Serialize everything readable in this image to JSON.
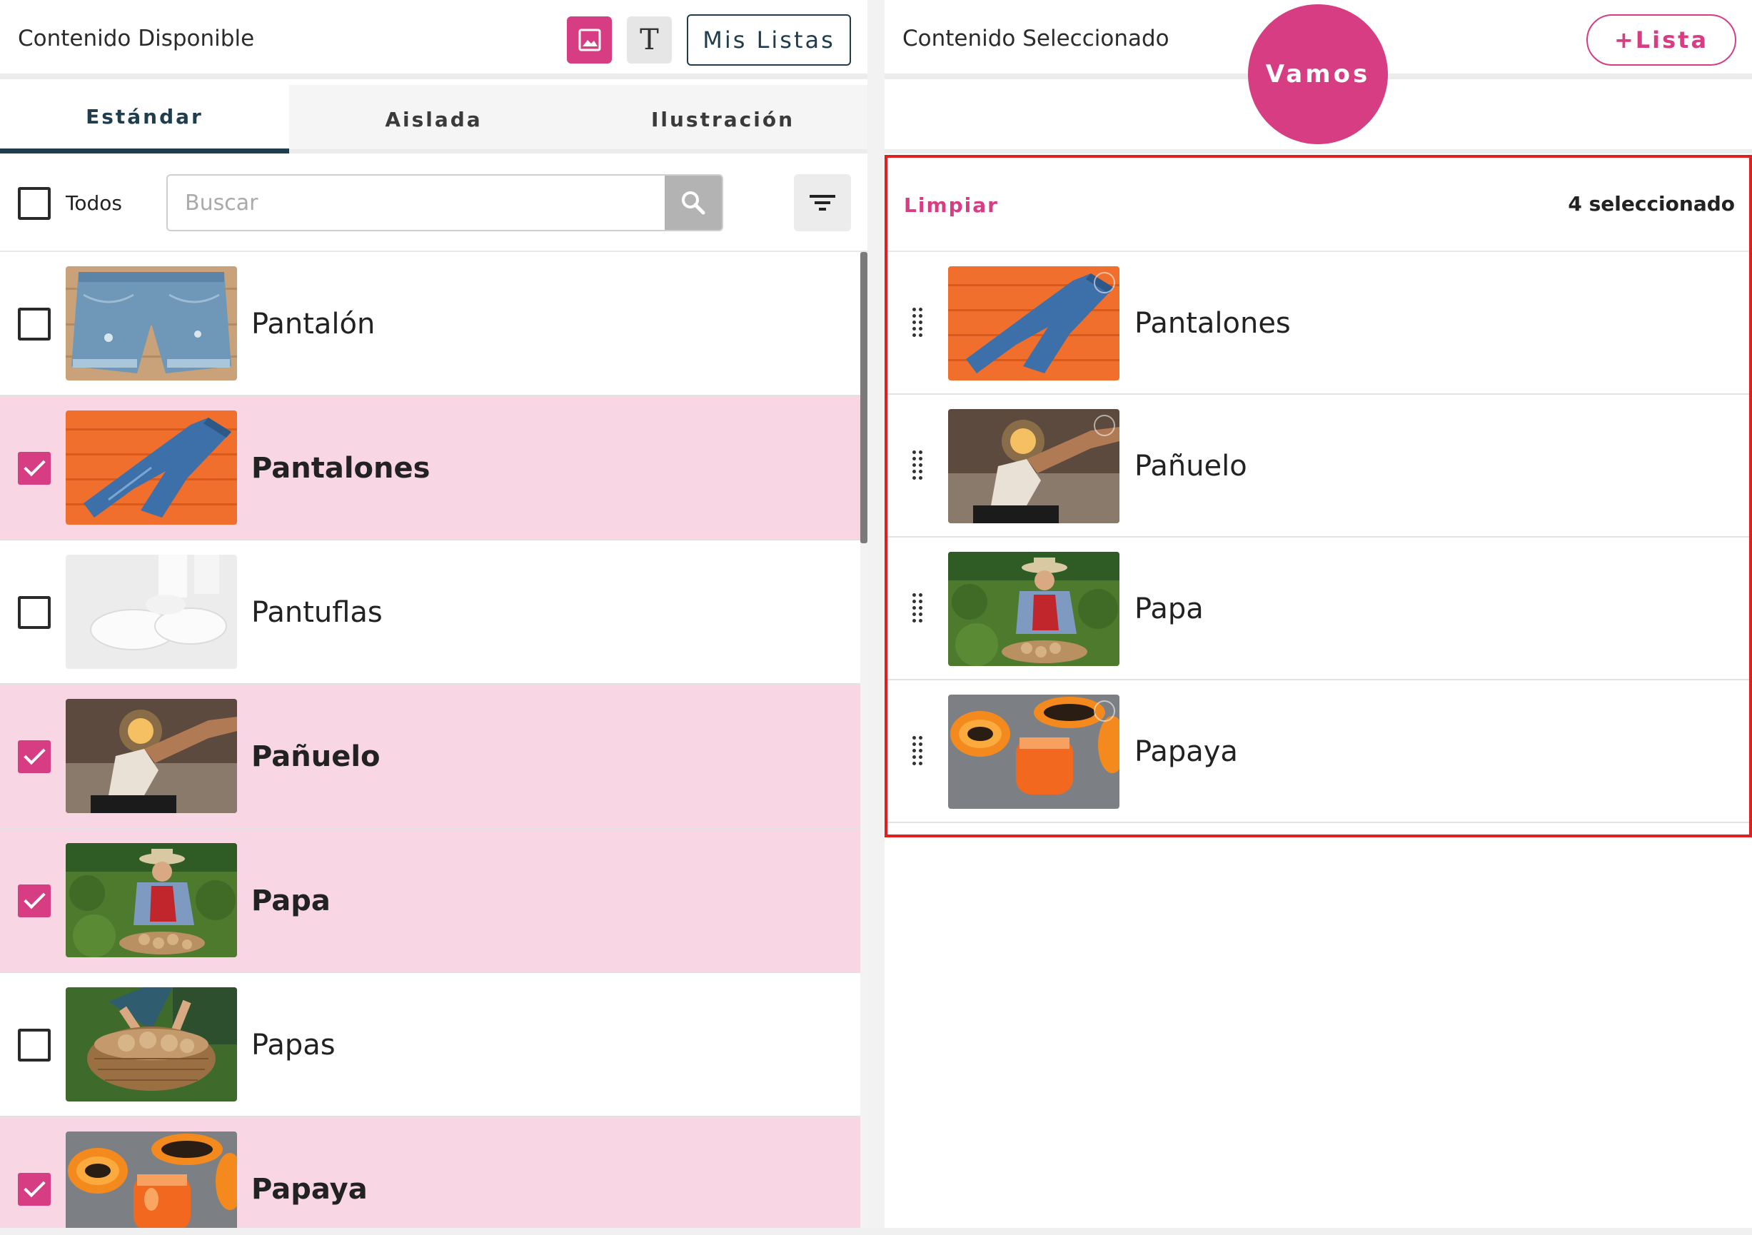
{
  "left_panel": {
    "title": "Contenido Disponible",
    "image_mode_icon": "image-icon",
    "text_mode_icon": "text-icon",
    "mis_listas_label": "Mis Listas",
    "tabs": [
      {
        "label": "Estándar",
        "active": true
      },
      {
        "label": "Aislada",
        "active": false
      },
      {
        "label": "Ilustración",
        "active": false
      }
    ],
    "select_all_label": "Todos",
    "search_placeholder": "Buscar",
    "items": [
      {
        "label": "Pantalón",
        "checked": false
      },
      {
        "label": "Pantalones",
        "checked": true
      },
      {
        "label": "Pantuflas",
        "checked": false
      },
      {
        "label": "Pañuelo",
        "checked": true
      },
      {
        "label": "Papa",
        "checked": true
      },
      {
        "label": "Papas",
        "checked": false
      },
      {
        "label": "Papaya",
        "checked": true
      }
    ]
  },
  "right_panel": {
    "title": "Contenido Seleccionado",
    "add_list_label": "+Lista",
    "go_label": "Vamos",
    "clear_label": "Limpiar",
    "count_label": "4 seleccionado",
    "selected_items": [
      {
        "label": "Pantalones"
      },
      {
        "label": "Pañuelo"
      },
      {
        "label": "Papa"
      },
      {
        "label": "Papaya"
      }
    ]
  },
  "colors": {
    "accent": "#d73d82",
    "selected_row": "#f8d6e4",
    "dark_teal": "#1f3d4d",
    "highlight_border": "#e02020"
  }
}
